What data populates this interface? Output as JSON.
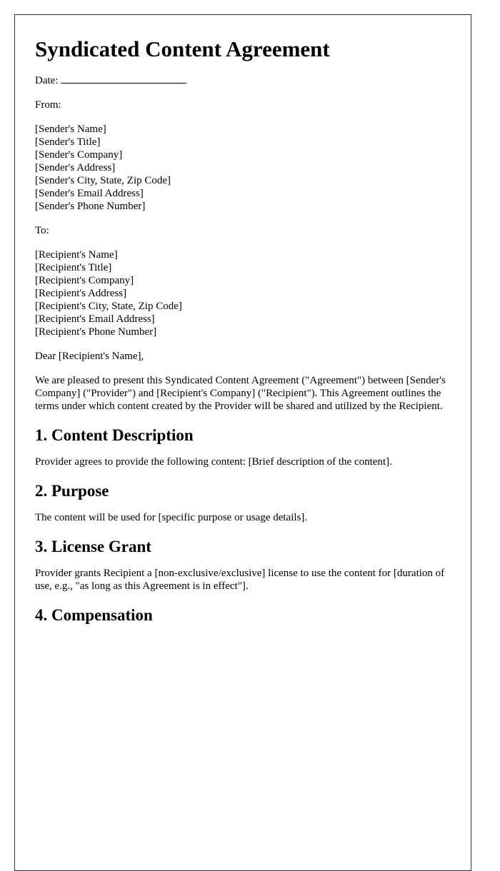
{
  "document": {
    "title": "Syndicated Content Agreement",
    "date_label": "Date:",
    "from_label": "From:",
    "sender": [
      "[Sender's Name]",
      "[Sender's Title]",
      "[Sender's Company]",
      "[Sender's Address]",
      "[Sender's City, State, Zip Code]",
      "[Sender's Email Address]",
      "[Sender's Phone Number]"
    ],
    "to_label": "To:",
    "recipient": [
      "[Recipient's Name]",
      "[Recipient's Title]",
      "[Recipient's Company]",
      "[Recipient's Address]",
      "[Recipient's City, State, Zip Code]",
      "[Recipient's Email Address]",
      "[Recipient's Phone Number]"
    ],
    "salutation": "Dear [Recipient's Name],",
    "intro": "We are pleased to present this Syndicated Content Agreement (\"Agreement\") between [Sender's Company] (\"Provider\") and [Recipient's Company] (\"Recipient\"). This Agreement outlines the terms under which content created by the Provider will be shared and utilized by the Recipient.",
    "sections": [
      {
        "heading": "1. Content Description",
        "body": "Provider agrees to provide the following content: [Brief description of the content]."
      },
      {
        "heading": "2. Purpose",
        "body": "The content will be used for [specific purpose or usage details]."
      },
      {
        "heading": "3. License Grant",
        "body": "Provider grants Recipient a [non-exclusive/exclusive] license to use the content for [duration of use, e.g., \"as long as this Agreement is in effect\"]."
      },
      {
        "heading": "4. Compensation",
        "body": ""
      }
    ]
  }
}
